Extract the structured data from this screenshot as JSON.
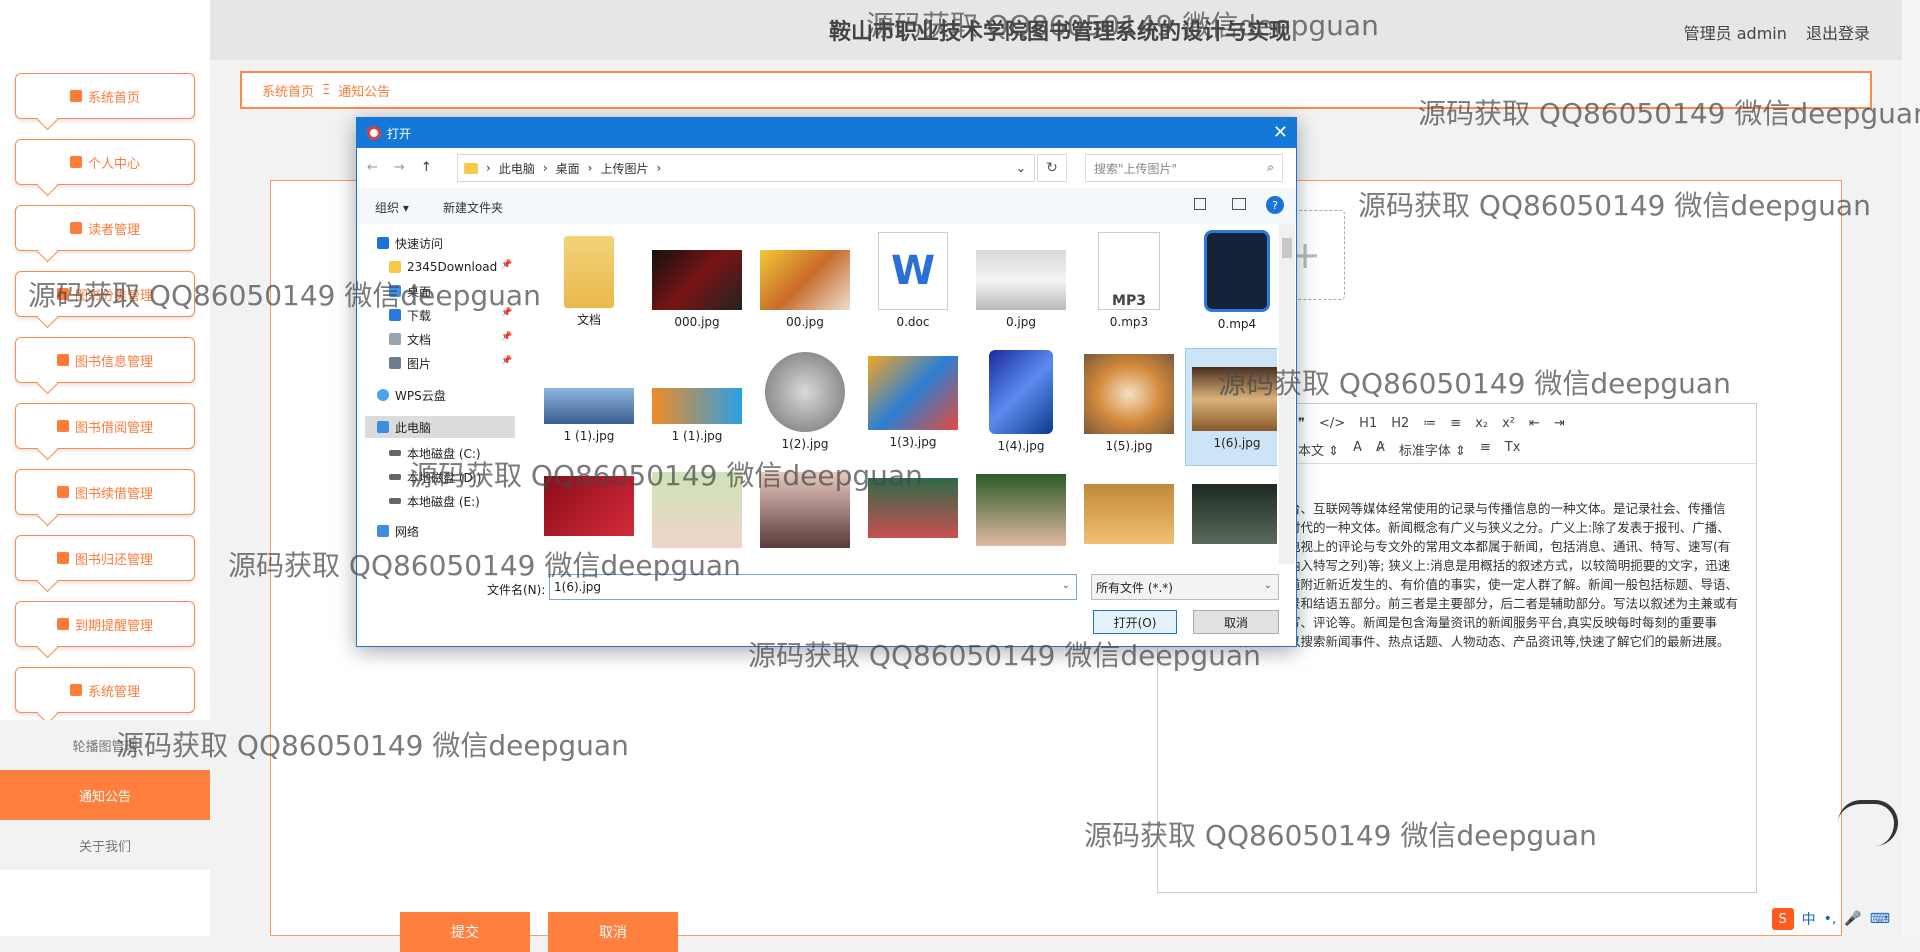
{
  "header": {
    "title": "鞍山市职业技术学院图书管理系统的设计与实现",
    "user": "管理员 admin",
    "logout": "退出登录"
  },
  "sidebar": {
    "items": [
      {
        "label": "系统首页",
        "icon": "home-icon"
      },
      {
        "label": "个人中心",
        "icon": "person-icon"
      },
      {
        "label": "读者管理",
        "icon": "briefcase-icon"
      },
      {
        "label": "图书分类管理",
        "icon": "tag-icon"
      },
      {
        "label": "图书信息管理",
        "icon": "book-icon"
      },
      {
        "label": "图书借阅管理",
        "icon": "bulb-icon"
      },
      {
        "label": "图书续借管理",
        "icon": "clipboard-icon"
      },
      {
        "label": "图书归还管理",
        "icon": "video-icon"
      },
      {
        "label": "到期提醒管理",
        "icon": "grid-icon"
      },
      {
        "label": "系统管理",
        "icon": "grid-icon"
      }
    ],
    "sub_items": [
      "轮播图管理",
      "通知公告",
      "关于我们"
    ]
  },
  "breadcrumb": {
    "home": "系统首页",
    "current": "通知公告",
    "sep": "Ξ"
  },
  "editor": {
    "toolbar_row1": [
      "❞",
      "</>",
      "H1",
      "H2",
      "≔",
      "≡",
      "x₂",
      "x²",
      "⇤",
      "⇥"
    ],
    "toolbar_row2": [
      "本文 ⇕",
      "A",
      "A̷",
      "标准字体 ⇕",
      "≡",
      "Tx"
    ],
    "text": "台、电视台、互联网等媒体经常使用的记录与传播信息的一种文体。是记录社会、传播信息、反映时代的一种文体。新闻概念有广义与狭义之分。广义上:除了发表于报刊、广播、互联网、电视上的评论与专文外的常用文本都属于新闻，包括消息、通讯、特写、速写(有的将速写纳入特写之列)等; 狭义上:消息是用概括的叙述方式，以较简明扼要的文字，迅速及时地报道附近新近发生的、有价值的事实，使一定人群了解。新闻一般包括标题、导语、主体、背景和结语五部分。前三者是主要部分，后二者是辅助部分。写法以叙述为主兼或有议论、描写、评论等。新闻是包含海量资讯的新闻服务平台,真实反映每时每刻的重要事件。您可以搜索新闻事件、热点话题、人物动态、产品资讯等,快速了解它们的最新进展。"
  },
  "buttons": {
    "submit": "提交",
    "cancel": "取消"
  },
  "tray": {
    "logo": "S",
    "ime": "中",
    "dot": "•,"
  },
  "dialog": {
    "title": "打开",
    "path": [
      "此电脑",
      "桌面",
      "上传图片"
    ],
    "search_placeholder": "搜索\"上传图片\"",
    "organize": "组织 ▾",
    "new_folder": "新建文件夹",
    "nav": [
      {
        "label": "快速访问",
        "icon": "star-icon"
      },
      {
        "label": "2345Download",
        "icon": "folder-icon"
      },
      {
        "label": "桌面",
        "icon": "folder-icon"
      },
      {
        "label": "下载",
        "icon": "download-icon"
      },
      {
        "label": "文档",
        "icon": "document-icon"
      },
      {
        "label": "图片",
        "icon": "picture-icon"
      },
      {
        "label": "WPS云盘",
        "icon": "cloud-icon"
      },
      {
        "label": "此电脑",
        "icon": "computer-icon"
      },
      {
        "label": "本地磁盘 (C:)",
        "icon": "drive-icon"
      },
      {
        "label": "本地磁盘 (D:)",
        "icon": "drive-icon"
      },
      {
        "label": "本地磁盘 (E:)",
        "icon": "drive-icon"
      },
      {
        "label": "网络",
        "icon": "network-icon"
      }
    ],
    "files_row1": [
      "文档",
      "000.jpg",
      "00.jpg",
      "0.doc",
      "0.jpg",
      "0.mp3",
      "0.mp4"
    ],
    "files_row2": [
      "1 (1).jpg",
      "1 (1).jpg",
      "1(2).jpg",
      "1(3).jpg",
      "1(4).jpg",
      "1(5).jpg",
      "1(6).jpg"
    ],
    "filename_label": "文件名(N):",
    "filename_value": "1(6).jpg",
    "filetype": "所有文件 (*.*)",
    "open": "打开(O)",
    "cancel": "取消"
  },
  "watermark": "源码获取 QQ86050149 微信deepguan"
}
